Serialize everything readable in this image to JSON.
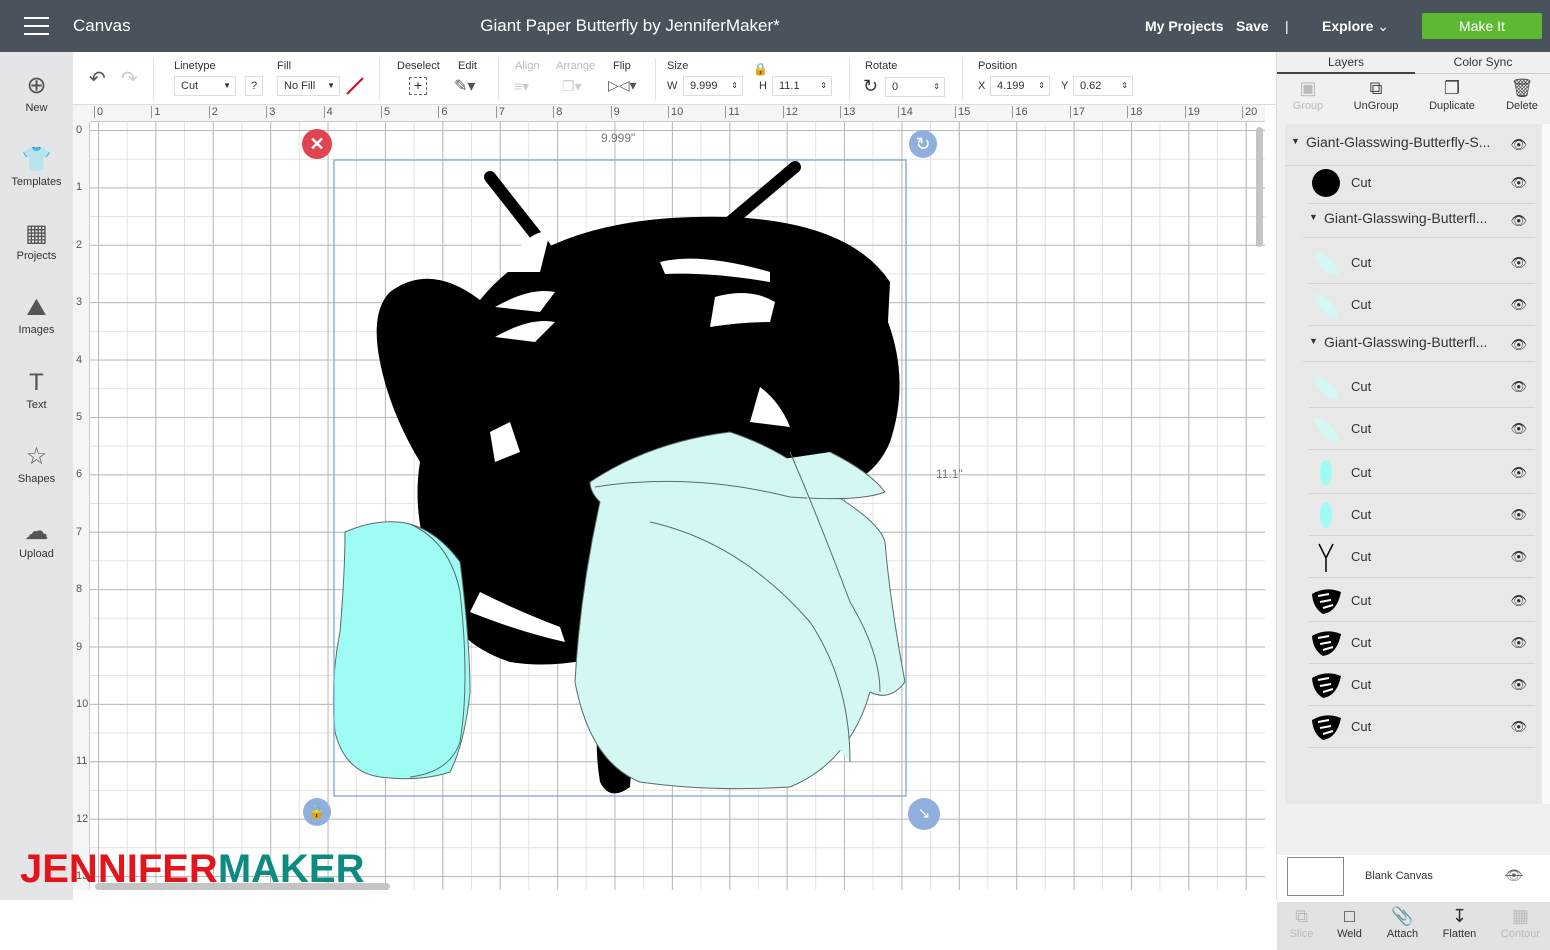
{
  "header": {
    "canvas_label": "Canvas",
    "title": "Giant Paper Butterfly by JenniferMaker*",
    "my_projects": "My Projects",
    "save": "Save",
    "divider": "|",
    "explore": "Explore",
    "make_it": "Make It",
    "make_it_color": "#5db832"
  },
  "left_nav": [
    {
      "label": "New",
      "icon": "plus-circle-icon"
    },
    {
      "label": "Templates",
      "icon": "shirt-icon"
    },
    {
      "label": "Projects",
      "icon": "projects-icon"
    },
    {
      "label": "Images",
      "icon": "image-icon"
    },
    {
      "label": "Text",
      "icon": "text-icon"
    },
    {
      "label": "Shapes",
      "icon": "shapes-icon"
    },
    {
      "label": "Upload",
      "icon": "upload-icon"
    }
  ],
  "toolbar": {
    "linetype_label": "Linetype",
    "linetype_value": "Cut",
    "help": "?",
    "fill_label": "Fill",
    "fill_value": "No Fill",
    "deselect": "Deselect",
    "edit": "Edit",
    "align": "Align",
    "arrange": "Arrange",
    "flip": "Flip",
    "size_label": "Size",
    "w_label": "W",
    "w_value": "9.999",
    "h_label": "H",
    "h_value": "11.1",
    "rotate_label": "Rotate",
    "rotate_value": "0",
    "position_label": "Position",
    "x_label": "X",
    "x_value": "4.199",
    "y_label": "Y",
    "y_value": "0.62"
  },
  "ruler": {
    "h": [
      "0",
      "1",
      "2",
      "3",
      "4",
      "5",
      "6",
      "7",
      "8",
      "9",
      "10",
      "11",
      "12",
      "13",
      "14",
      "15",
      "16",
      "17",
      "18",
      "19",
      "20"
    ],
    "v": [
      "0",
      "1",
      "2",
      "3",
      "4",
      "5",
      "6",
      "7",
      "8",
      "9",
      "10",
      "11",
      "12",
      "13"
    ]
  },
  "canvas": {
    "width_readout": "9.999\"",
    "height_readout": "11.1\"",
    "selection_color": "#8fb0dc",
    "wing_light": "#d3f7f2",
    "wing_bright": "#9ffcf5"
  },
  "panel": {
    "tabs": [
      "Layers",
      "Color Sync"
    ],
    "actions": [
      {
        "label": "Group",
        "disabled": true
      },
      {
        "label": "UnGroup"
      },
      {
        "label": "Duplicate"
      },
      {
        "label": "Delete"
      }
    ],
    "layers": [
      {
        "type": "group",
        "label": "Giant-Glasswing-Butterfly-S..."
      },
      {
        "type": "item",
        "label": "Cut",
        "thumb": "black-circle"
      },
      {
        "type": "group",
        "label": "Giant-Glasswing-Butterfl..."
      },
      {
        "type": "item",
        "label": "Cut",
        "thumb": "light-wing"
      },
      {
        "type": "item",
        "label": "Cut",
        "thumb": "light-wing"
      },
      {
        "type": "group",
        "label": "Giant-Glasswing-Butterfl..."
      },
      {
        "type": "item",
        "label": "Cut",
        "thumb": "light-wing"
      },
      {
        "type": "item",
        "label": "Cut",
        "thumb": "light-wing"
      },
      {
        "type": "item",
        "label": "Cut",
        "thumb": "light-oval"
      },
      {
        "type": "item",
        "label": "Cut",
        "thumb": "light-oval"
      },
      {
        "type": "item",
        "label": "Cut",
        "thumb": "antenna"
      },
      {
        "type": "item",
        "label": "Cut",
        "thumb": "black-wing"
      },
      {
        "type": "item",
        "label": "Cut",
        "thumb": "black-wing"
      },
      {
        "type": "item",
        "label": "Cut",
        "thumb": "black-wing"
      },
      {
        "type": "item",
        "label": "Cut",
        "thumb": "black-wing"
      }
    ],
    "blank_canvas": "Blank Canvas",
    "bottom_actions": [
      {
        "label": "Slice",
        "disabled": true
      },
      {
        "label": "Weld"
      },
      {
        "label": "Attach"
      },
      {
        "label": "Flatten"
      },
      {
        "label": "Contour",
        "disabled": true
      }
    ]
  },
  "watermark": {
    "part1": "JENNIFER",
    "part2": "MAKER",
    "color1": "#e3141b",
    "color2": "#0e8b80"
  }
}
